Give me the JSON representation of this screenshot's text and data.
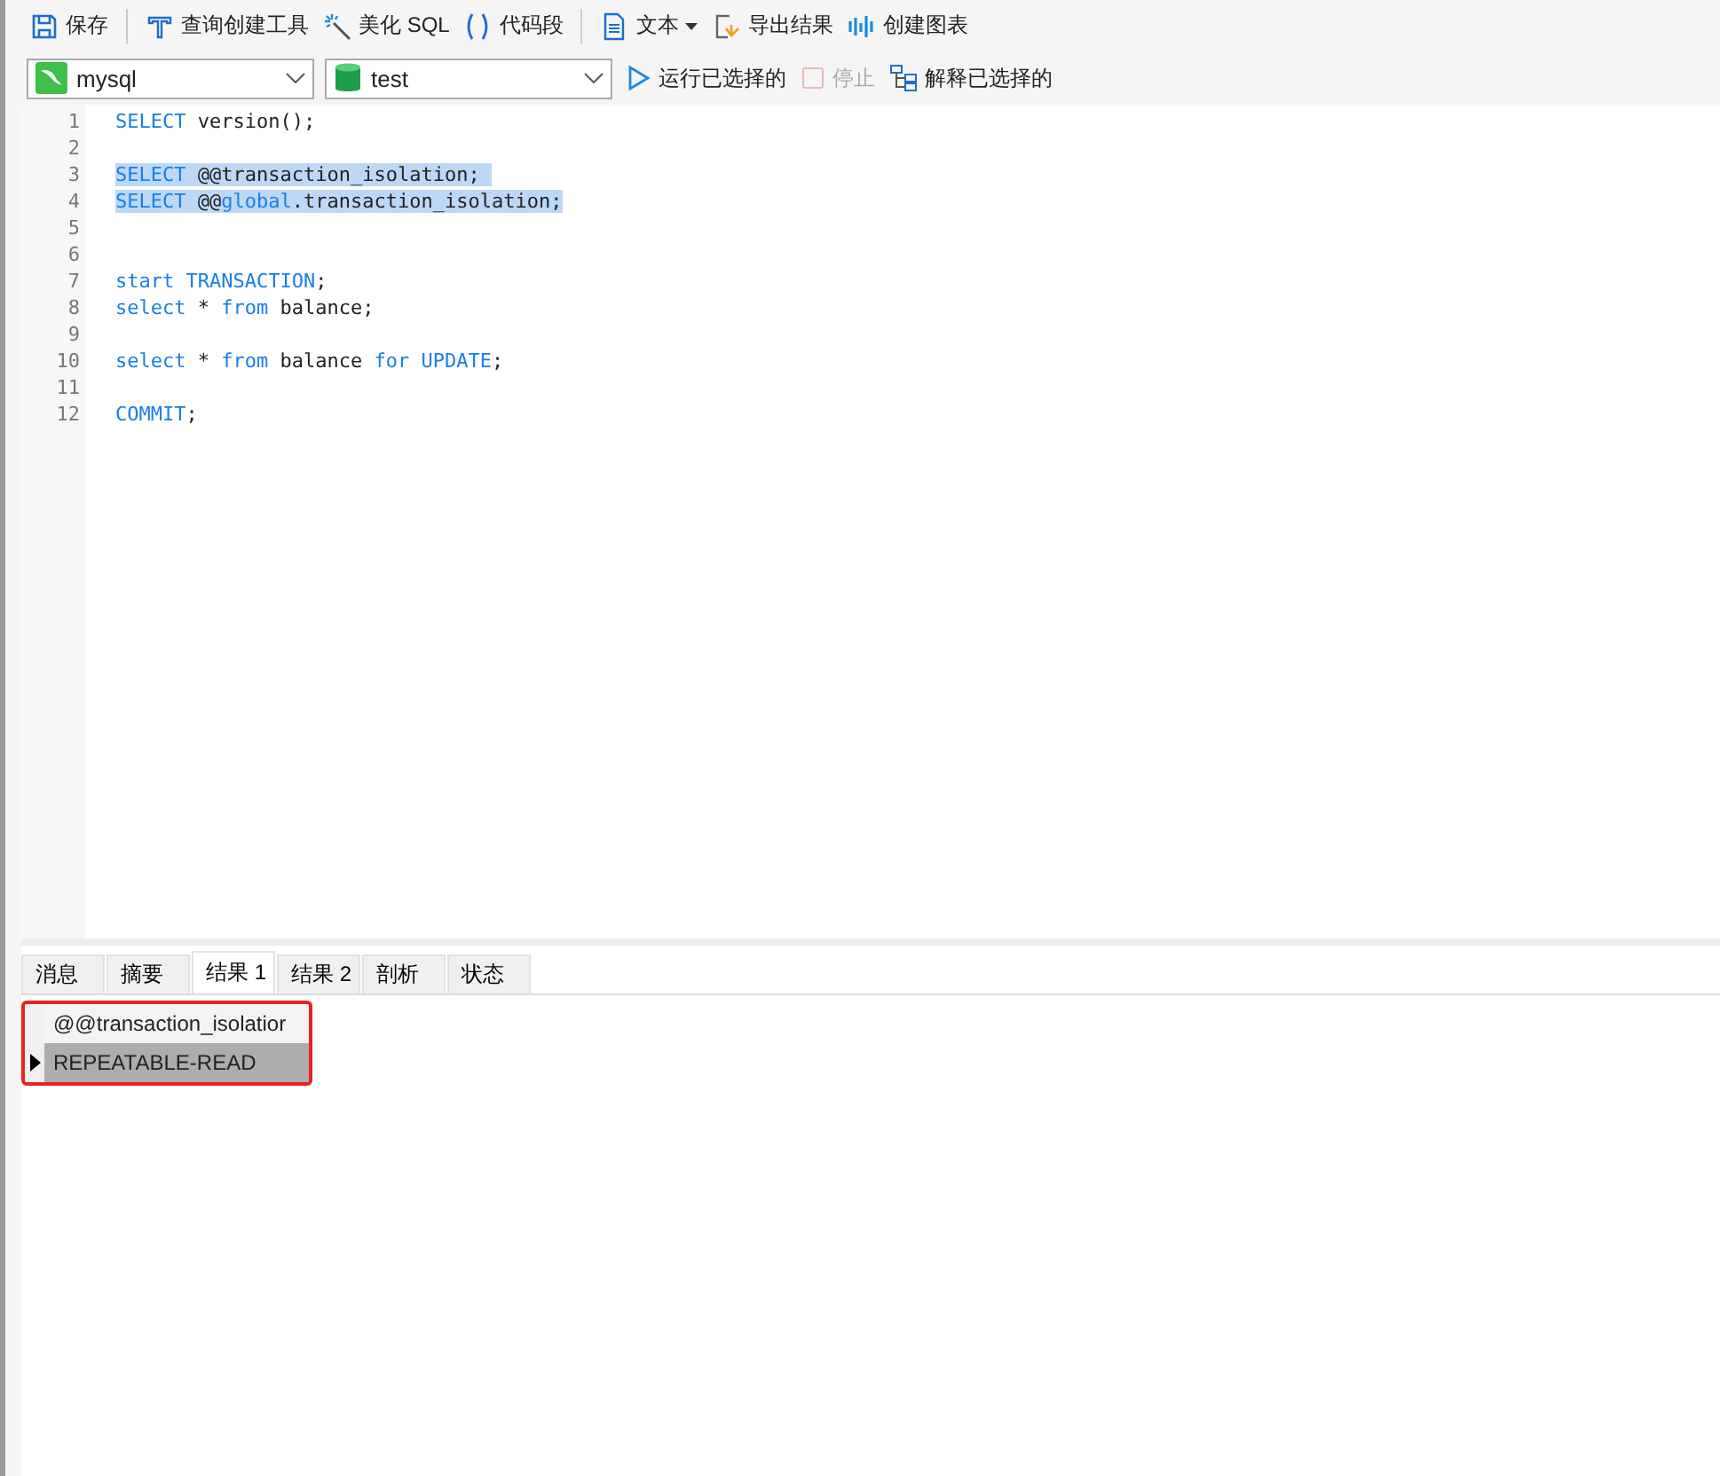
{
  "toolbar": [
    {
      "kind": "save",
      "label": "保存",
      "group_end": true
    },
    {
      "kind": "query",
      "label": "查询创建工具"
    },
    {
      "kind": "beautify",
      "label": "美化 SQL"
    },
    {
      "kind": "snippet",
      "label": "代码段",
      "group_end": true
    },
    {
      "kind": "text",
      "label": "文本",
      "dropdown": true
    },
    {
      "kind": "export",
      "label": "导出结果"
    },
    {
      "kind": "chart",
      "label": "创建图表"
    }
  ],
  "connection": {
    "kind": "mysql",
    "value": "mysql"
  },
  "database": {
    "kind": "db",
    "value": "test"
  },
  "actions": [
    {
      "kind": "run",
      "label": "运行已选择的",
      "disabled": false
    },
    {
      "kind": "stop",
      "label": "停止",
      "disabled": true
    },
    {
      "kind": "explain",
      "label": "解释已选择的",
      "disabled": false
    }
  ],
  "editor": {
    "lines": [
      {
        "number": "1",
        "selected": false,
        "tokens": [
          {
            "kind": "kw",
            "text": "SELECT"
          },
          {
            "kind": "plain",
            "text": " version();"
          }
        ]
      },
      {
        "number": "2"
      },
      {
        "number": "3",
        "selected": true,
        "tokens": [
          {
            "kind": "kw",
            "text": "SELECT"
          },
          {
            "kind": "plain",
            "text": " @@transaction_isolation; "
          }
        ]
      },
      {
        "number": "4",
        "selected": true,
        "tokens": [
          {
            "kind": "kw",
            "text": "SELECT"
          },
          {
            "kind": "plain",
            "text": " @@"
          },
          {
            "kind": "kw",
            "text": "global"
          },
          {
            "kind": "plain",
            "text": ".transaction_isolation;"
          }
        ]
      },
      {
        "number": "5"
      },
      {
        "number": "6"
      },
      {
        "number": "7",
        "selected": false,
        "tokens": [
          {
            "kind": "kw",
            "text": "start"
          },
          {
            "kind": "kw",
            "text": " TRANSACTION"
          },
          {
            "kind": "plain",
            "text": ";"
          }
        ]
      },
      {
        "number": "8",
        "selected": false,
        "tokens": [
          {
            "kind": "kw",
            "text": "select"
          },
          {
            "kind": "plain",
            "text": " * "
          },
          {
            "kind": "kw",
            "text": "from"
          },
          {
            "kind": "plain",
            "text": " balance;"
          }
        ]
      },
      {
        "number": "9"
      },
      {
        "number": "10",
        "selected": false,
        "tokens": [
          {
            "kind": "kw",
            "text": "select"
          },
          {
            "kind": "plain",
            "text": " * "
          },
          {
            "kind": "kw",
            "text": "from"
          },
          {
            "kind": "plain",
            "text": " balance "
          },
          {
            "kind": "kw",
            "text": "for"
          },
          {
            "kind": "kw",
            "text": " UPDATE"
          },
          {
            "kind": "plain",
            "text": ";"
          }
        ]
      },
      {
        "number": "11"
      },
      {
        "number": "12",
        "selected": false,
        "tokens": [
          {
            "kind": "kw",
            "text": "COMMIT"
          },
          {
            "kind": "plain",
            "text": ";"
          }
        ]
      }
    ]
  },
  "result_tabs": [
    {
      "label": "消息",
      "selected": false
    },
    {
      "label": "摘要",
      "selected": false
    },
    {
      "label": "结果 1",
      "selected": true
    },
    {
      "label": "结果 2",
      "selected": false
    },
    {
      "label": "剖析",
      "selected": false
    },
    {
      "label": "状态",
      "selected": false
    }
  ],
  "result_grid": {
    "highlighted": true,
    "columns": [
      "@@transaction_isolatior"
    ],
    "rows": [
      {
        "selected": true,
        "cells": [
          "REPEATABLE-READ"
        ]
      }
    ]
  }
}
